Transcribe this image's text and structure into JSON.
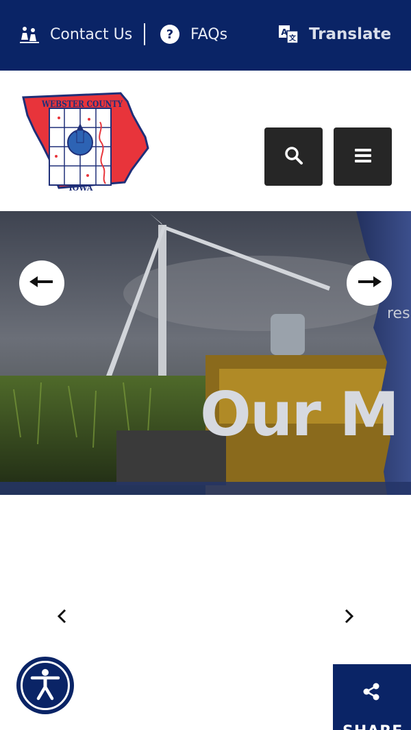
{
  "topbar": {
    "contact_label": "Contact Us",
    "faqs_label": "FAQs",
    "translate_label": "Translate"
  },
  "header": {
    "logo_text_top": "WEBSTER COUNTY",
    "logo_text_bottom": "IOWA"
  },
  "hero": {
    "title": "Our M",
    "subtitle": "res"
  },
  "share": {
    "label": "SHARE"
  },
  "colors": {
    "navy": "#0a2466",
    "dark_button": "#262626",
    "white": "#ffffff"
  },
  "icons": [
    "people-icon",
    "question-icon",
    "translate-icon",
    "search-icon",
    "hamburger-icon",
    "arrow-left-icon",
    "arrow-right-icon",
    "chevron-left-icon",
    "chevron-right-icon",
    "accessibility-icon",
    "share-icon"
  ]
}
